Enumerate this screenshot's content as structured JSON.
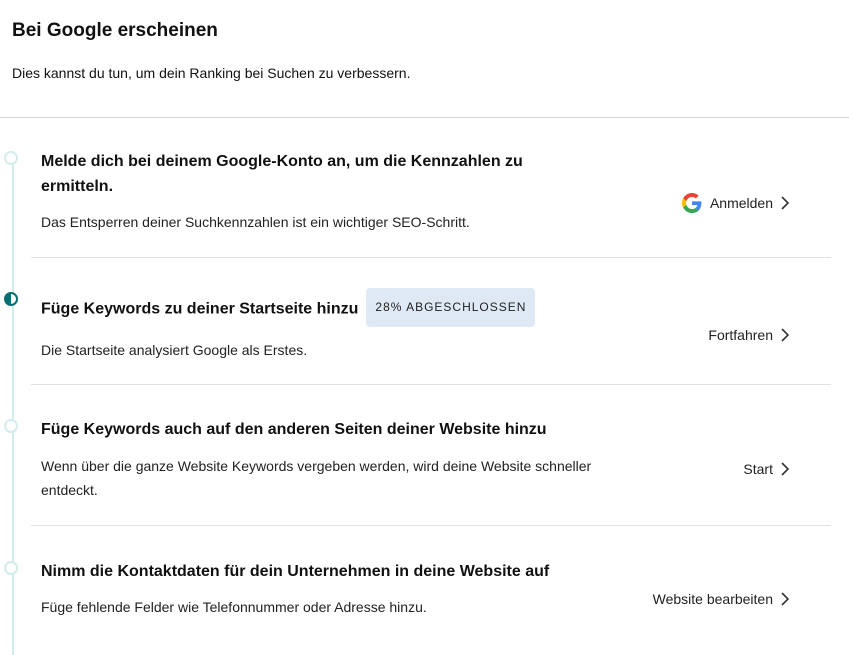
{
  "header": {
    "title": "Bei Google erscheinen",
    "subtitle": "Dies kannst du tun, um dein Ranking bei Suchen zu verbessern."
  },
  "steps": [
    {
      "title_line1": "Melde dich bei deinem Google-Konto an, um die Kennzahlen zu",
      "title_line2": "ermitteln.",
      "description": "Das Entsperren deiner Suchkennzahlen ist ein wichtiger SEO-Schritt.",
      "action": "Anmelden",
      "icon": "google-icon"
    },
    {
      "title": "Füge Keywords zu deiner Startseite hinzu",
      "badge": "28% ABGESCHLOSSEN",
      "progress_percent": 28,
      "description": "Die Startseite analysiert Google als Erstes.",
      "action": "Fortfahren"
    },
    {
      "title": "Füge Keywords auch auf den anderen Seiten deiner Website hinzu",
      "description_line1": "Wenn über die ganze Website Keywords vergeben werden, wird deine Website schneller",
      "description_line2": "entdeckt.",
      "action": "Start"
    },
    {
      "title": "Nimm die Kontaktdaten für dein Unternehmen in deine Website auf",
      "description": "Füge fehlende Felder wie Telefonnummer oder Adresse hinzu.",
      "action": "Website bearbeiten"
    }
  ],
  "colors": {
    "timeline": "#d3ecec",
    "progress_accent": "#0b6e6e",
    "badge_bg": "#dfe9f5"
  }
}
